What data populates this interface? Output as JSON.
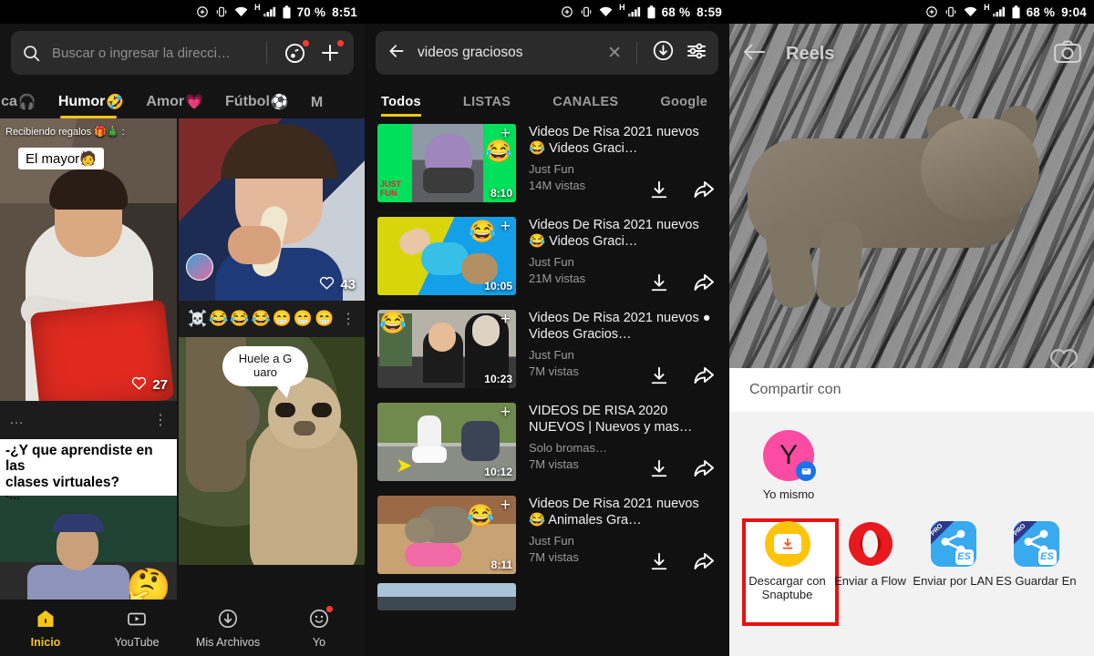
{
  "panel1": {
    "status": {
      "battery_pct": "70 %",
      "time": "8:51",
      "network": "H"
    },
    "search": {
      "placeholder": "Buscar o ingresar la direcci…",
      "icons": [
        "search-icon",
        "music-discover-icon",
        "add-tab-icon"
      ]
    },
    "category_tabs": [
      {
        "label": "úsica",
        "emoji": "🎧",
        "active": false
      },
      {
        "label": "Humor",
        "emoji": "🤣",
        "active": true
      },
      {
        "label": "Amor",
        "emoji": "💗",
        "active": false
      },
      {
        "label": "Fútbol",
        "emoji": "⚽",
        "active": false
      },
      {
        "label": "M",
        "emoji": "",
        "active": false
      }
    ],
    "cards": {
      "card1": {
        "caption_top": "Recibiendo regalos 🎁🎄 :",
        "caption_box": "El mayor🧑",
        "likes": "27"
      },
      "card2": {
        "more": "…",
        "menu": "⋮"
      },
      "card3": {
        "line1": "-¿Y que aprendiste en las",
        "line2": "clases virtuales?",
        "line3": "-…"
      },
      "card4": {
        "likes": "43"
      },
      "card5": {
        "emojis": [
          "☠️",
          "😂",
          "😂",
          "😂",
          "😁",
          "😁",
          "😁"
        ],
        "menu": "⋮"
      },
      "card6": {
        "bubble": "Huele a G uaro"
      }
    },
    "bottom_nav": [
      {
        "label": "Inicio",
        "icon": "home-icon",
        "active": true,
        "dot": false
      },
      {
        "label": "YouTube",
        "icon": "youtube-icon",
        "active": false,
        "dot": false
      },
      {
        "label": "Mis Archivos",
        "icon": "download-circle-icon",
        "active": false,
        "dot": false
      },
      {
        "label": "Yo",
        "icon": "profile-face-icon",
        "active": false,
        "dot": true
      }
    ]
  },
  "panel2": {
    "status": {
      "battery_pct": "68 %",
      "time": "8:59",
      "network": "H"
    },
    "search": {
      "query": "videos graciosos",
      "clear": "✕"
    },
    "result_tabs": [
      {
        "label": "Todos",
        "active": true
      },
      {
        "label": "LISTAS",
        "active": false
      },
      {
        "label": "CANALES",
        "active": false
      },
      {
        "label": "Google",
        "active": false
      }
    ],
    "results": [
      {
        "title": "Videos De Risa 2021 nuevos 😂 Videos Graci…",
        "channel": "Just Fun",
        "views": "14M vistas",
        "duration": "8:10",
        "emoji": "😂"
      },
      {
        "title": "Videos De Risa 2021 nuevos 😂 Videos Graci…",
        "channel": "Just Fun",
        "views": "21M vistas",
        "duration": "10:05",
        "emoji": "😂"
      },
      {
        "title": "Videos De Risa 2021 nuevos ● Videos Gracios…",
        "channel": "Just Fun",
        "views": "7M vistas",
        "duration": "10:23",
        "emoji": "😂"
      },
      {
        "title": "VIDEOS DE RISA 2020 NUEVOS | Nuevos y mas…",
        "channel": "Solo bromas…",
        "views": "7M vistas",
        "duration": "10:12",
        "emoji": ""
      },
      {
        "title": "Videos De Risa 2021 nuevos 😂 Animales Gra…",
        "channel": "Just Fun",
        "views": "7M vistas",
        "duration": "8:11",
        "emoji": "😂"
      }
    ]
  },
  "panel3": {
    "status": {
      "battery_pct": "68 %",
      "time": "9:04",
      "network": "H"
    },
    "reels": {
      "title": "Reels",
      "back_icon": "back-arrow-icon",
      "camera_icon": "camera-icon",
      "like_icon": "heart-icon"
    },
    "share_sheet": {
      "title": "Compartir con",
      "contacts": [
        {
          "name": "Yo mismo",
          "initial": "Y",
          "avatar_color": "#fb4ba2",
          "badge": "messages-icon"
        }
      ],
      "apps": [
        {
          "label": "Descargar con Snaptube",
          "icon": "snaptube-icon",
          "highlighted": true
        },
        {
          "label": "Enviar a Flow",
          "icon": "opera-flow-icon",
          "highlighted": false
        },
        {
          "label": "Enviar por LAN",
          "icon": "es-lan-share-icon",
          "highlighted": false
        },
        {
          "label": "ES Guardar En",
          "icon": "es-save-icon",
          "highlighted": false
        }
      ],
      "highlight_color": "#e8110f"
    }
  }
}
